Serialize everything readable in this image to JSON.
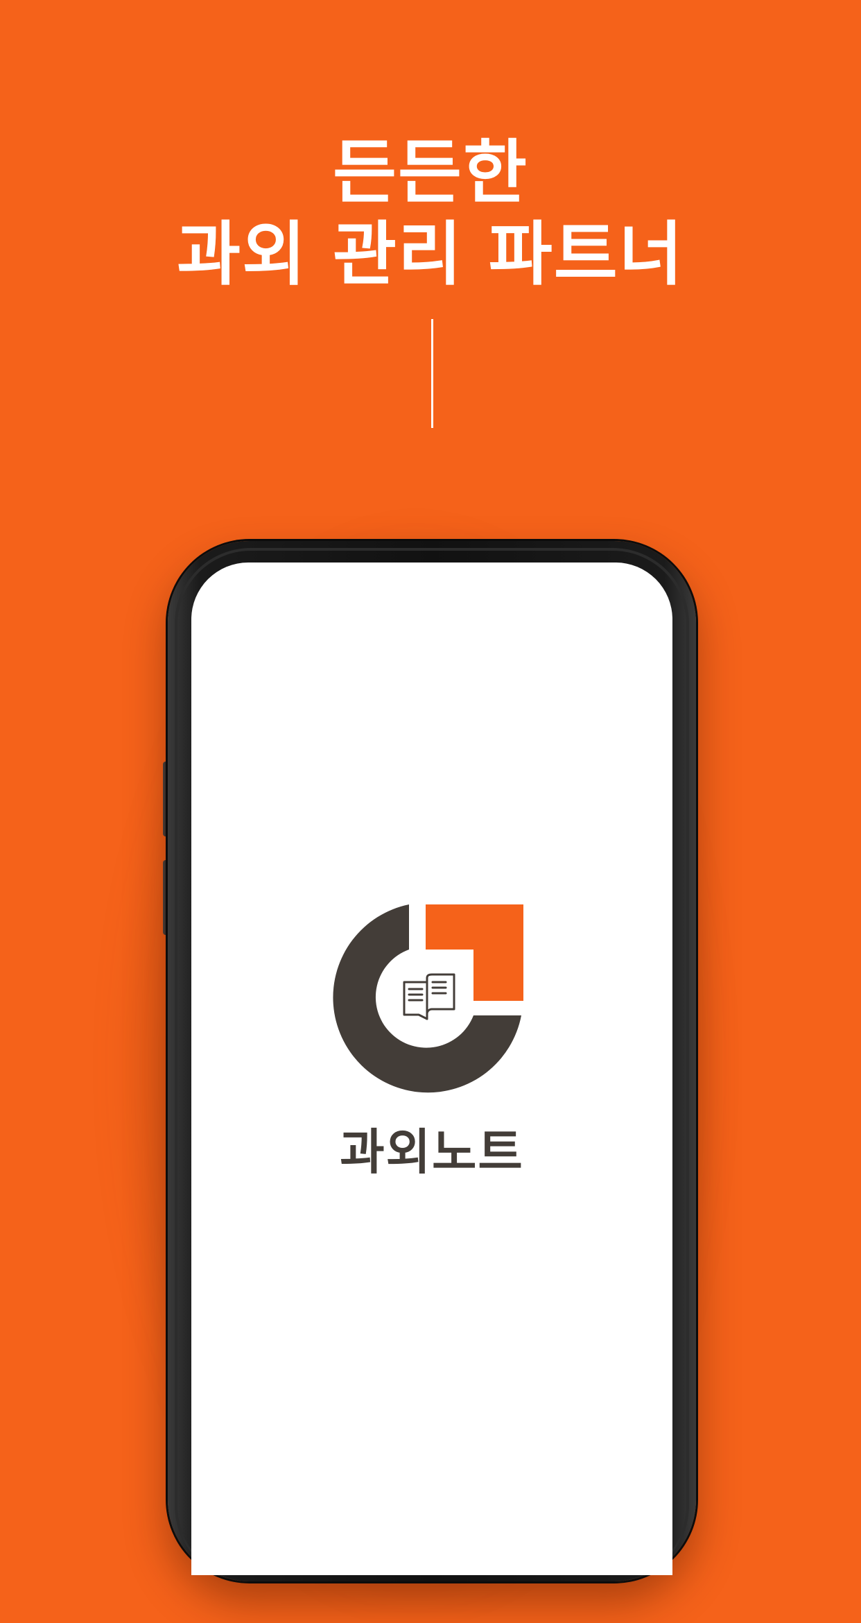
{
  "headline": {
    "line1": "든든한",
    "line2": "과외 관리 파트너"
  },
  "app": {
    "name": "과외노트",
    "logo_icon": "open-book-icon"
  },
  "colors": {
    "background": "#F5621A",
    "accent": "#F5621A",
    "logo_dark": "#433D38",
    "screen": "#FFFFFF",
    "headline_text": "#FFFFFF"
  }
}
